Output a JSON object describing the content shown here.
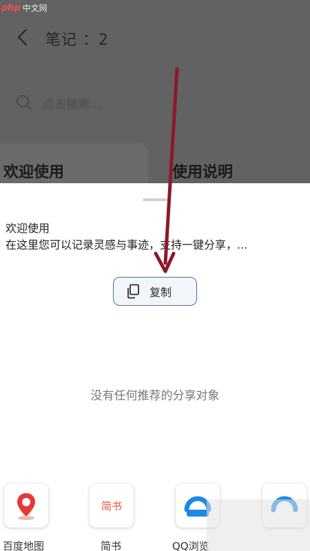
{
  "watermark": {
    "brand": "php",
    "site": "中文网"
  },
  "header": {
    "title": "笔记 ：2"
  },
  "search": {
    "placeholder": "点击搜索..."
  },
  "notes": [
    {
      "title": "欢迎使用"
    },
    {
      "title": "使用说明"
    }
  ],
  "share_sheet": {
    "preview_title": "欢迎使用",
    "preview_body": "在这里您可以记录灵感与事迹，支持一键分享，...",
    "copy_label": "复制",
    "empty_text": "没有任何推荐的分享对象",
    "apps": [
      {
        "label": "百度地图",
        "icon": "baidu-map-icon"
      },
      {
        "label": "简书",
        "icon": "jianshu-icon",
        "logo_text": "简书"
      },
      {
        "label": "QQ浏览",
        "icon": "qq-browser-icon"
      },
      {
        "label": "",
        "icon": "qq-browser-icon"
      }
    ]
  },
  "colors": {
    "annotation_arrow": "#8b1a2b",
    "copy_border": "#4f6f86",
    "dim_overlay": "#626262"
  }
}
